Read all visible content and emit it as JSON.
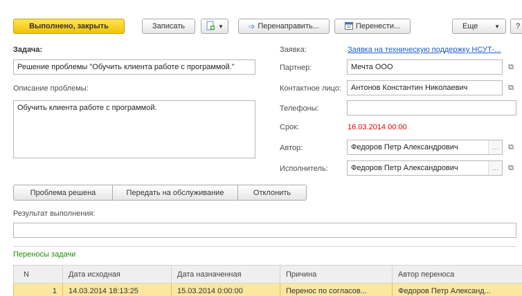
{
  "toolbar": {
    "done_close": "Выполнено, закрыть",
    "save": "Записать",
    "redirect": "Перенаправить...",
    "transfer": "Перенести...",
    "more": "Еще",
    "help": "?"
  },
  "task": {
    "label": "Задача:",
    "value": "Решение проблемы \"Обучить клиента работе с программой.\""
  },
  "description": {
    "label": "Описание проблемы:",
    "value": "Обучить клиента работе с программой."
  },
  "request": {
    "label": "Заявка:",
    "value": "Заявка на техническую поддержку НСУТ-..."
  },
  "partner": {
    "label": "Партнер:",
    "value": "Мечта ООО"
  },
  "contact": {
    "label": "Контактное лицо:",
    "value": "Антонов Константин Николаевич"
  },
  "phones": {
    "label": "Телефоны:",
    "value": ""
  },
  "deadline": {
    "label": "Срок:",
    "value": "16.03.2014 00:00"
  },
  "author": {
    "label": "Автор:",
    "value": "Федоров Петр Александрович"
  },
  "executor": {
    "label": "Исполнитель:",
    "value": "Федоров Петр Александрович"
  },
  "actions": {
    "solved": "Проблема решена",
    "to_service": "Передать на обслуживание",
    "reject": "Отклонить"
  },
  "result": {
    "label": "Результат выполнения:",
    "value": ""
  },
  "transfers": {
    "title": "Переносы задачи",
    "columns": [
      "N",
      "Дата исходная",
      "Дата назначенная",
      "Причина",
      "Автор переноса"
    ],
    "rows": [
      [
        "1",
        "14.03.2014 18:13:25",
        "15.03.2014 0:00:00",
        "Перенос по согласов...",
        "Федоров Петр Александ..."
      ]
    ]
  },
  "colors": {
    "primary_button": "#f2c200",
    "link": "#1a5ccc",
    "deadline": "#e00000",
    "section_title": "#1c9000",
    "selected_row": "#fbe7a0"
  }
}
